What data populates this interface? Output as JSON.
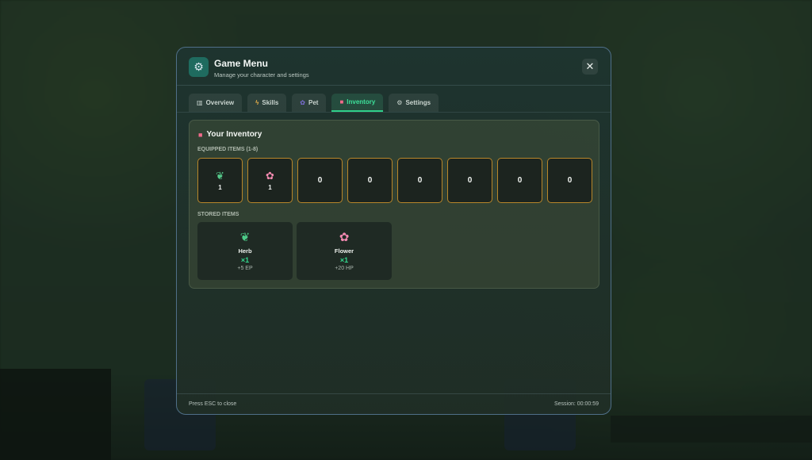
{
  "header": {
    "icon": "gear-icon",
    "title": "Game Menu",
    "subtitle": "Manage your character and settings",
    "close_icon": "close-icon"
  },
  "tabs": [
    {
      "label": "Overview",
      "icon": "chart-icon",
      "active": false
    },
    {
      "label": "Skills",
      "icon": "lightning-icon",
      "active": false
    },
    {
      "label": "Pet",
      "icon": "paw-icon",
      "active": false
    },
    {
      "label": "Inventory",
      "icon": "backpack-icon",
      "active": true
    },
    {
      "label": "Settings",
      "icon": "gear-icon",
      "active": false
    }
  ],
  "inventory": {
    "title": "Your Inventory",
    "equipped_label": "EQUIPPED ITEMS (1-8)",
    "equipped": [
      {
        "icon": "herb-icon",
        "count": "1"
      },
      {
        "icon": "flower-icon",
        "count": "1"
      },
      {
        "icon": "",
        "count": "0"
      },
      {
        "icon": "",
        "count": "0"
      },
      {
        "icon": "",
        "count": "0"
      },
      {
        "icon": "",
        "count": "0"
      },
      {
        "icon": "",
        "count": "0"
      },
      {
        "icon": "",
        "count": "0"
      }
    ],
    "stored_label": "STORED ITEMS",
    "stored": [
      {
        "icon": "herb-icon",
        "name": "Herb",
        "qty": "×1",
        "effect": "+5 EP"
      },
      {
        "icon": "flower-icon",
        "name": "Flower",
        "qty": "×1",
        "effect": "+20 HP"
      }
    ]
  },
  "footer": {
    "hint": "Press ESC to close",
    "session": "Session: 00:00:59"
  },
  "colors": {
    "accent": "#2fd08a",
    "slot_border": "#b8862a",
    "modal_border": "#4f6f88"
  }
}
